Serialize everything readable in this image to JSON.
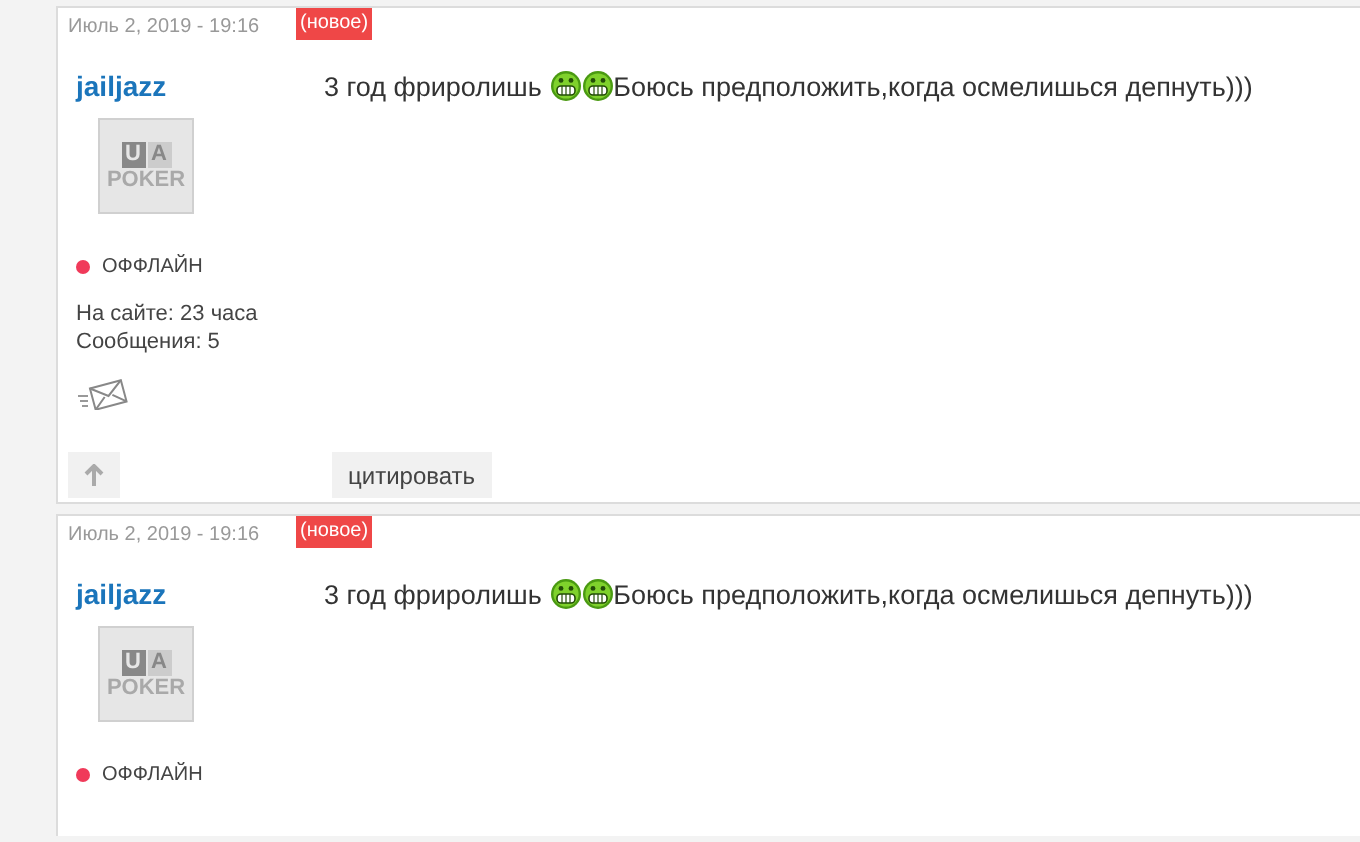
{
  "posts": [
    {
      "date": "Июль 2, 2019 - 19:16",
      "badge": "(новое)",
      "username": "jailjazz",
      "avatar": {
        "letters": [
          "U",
          "A"
        ],
        "word": "POKER"
      },
      "status": {
        "label": "ОФФЛАЙН",
        "online": false
      },
      "stats": [
        "На сайте: 23 часа",
        "Сообщения: 5"
      ],
      "message": [
        {
          "kind": "text",
          "text": "3 год фриролишь "
        },
        {
          "kind": "emoji"
        },
        {
          "kind": "emoji"
        },
        {
          "kind": "text",
          "text": "Боюсь предположить,когда осмелишься депнуть)))"
        }
      ],
      "quote_button": "цитировать"
    },
    {
      "date": "Июль 2, 2019 - 19:16",
      "badge": "(новое)",
      "username": "jailjazz",
      "avatar": {
        "letters": [
          "U",
          "A"
        ],
        "word": "POKER"
      },
      "status": {
        "label": "ОФФЛАЙН",
        "online": false
      },
      "message": [
        {
          "kind": "text",
          "text": "3 год фриролишь "
        },
        {
          "kind": "emoji"
        },
        {
          "kind": "emoji"
        },
        {
          "kind": "text",
          "text": "Боюсь предположить,когда осмелишься депнуть)))"
        }
      ]
    }
  ]
}
